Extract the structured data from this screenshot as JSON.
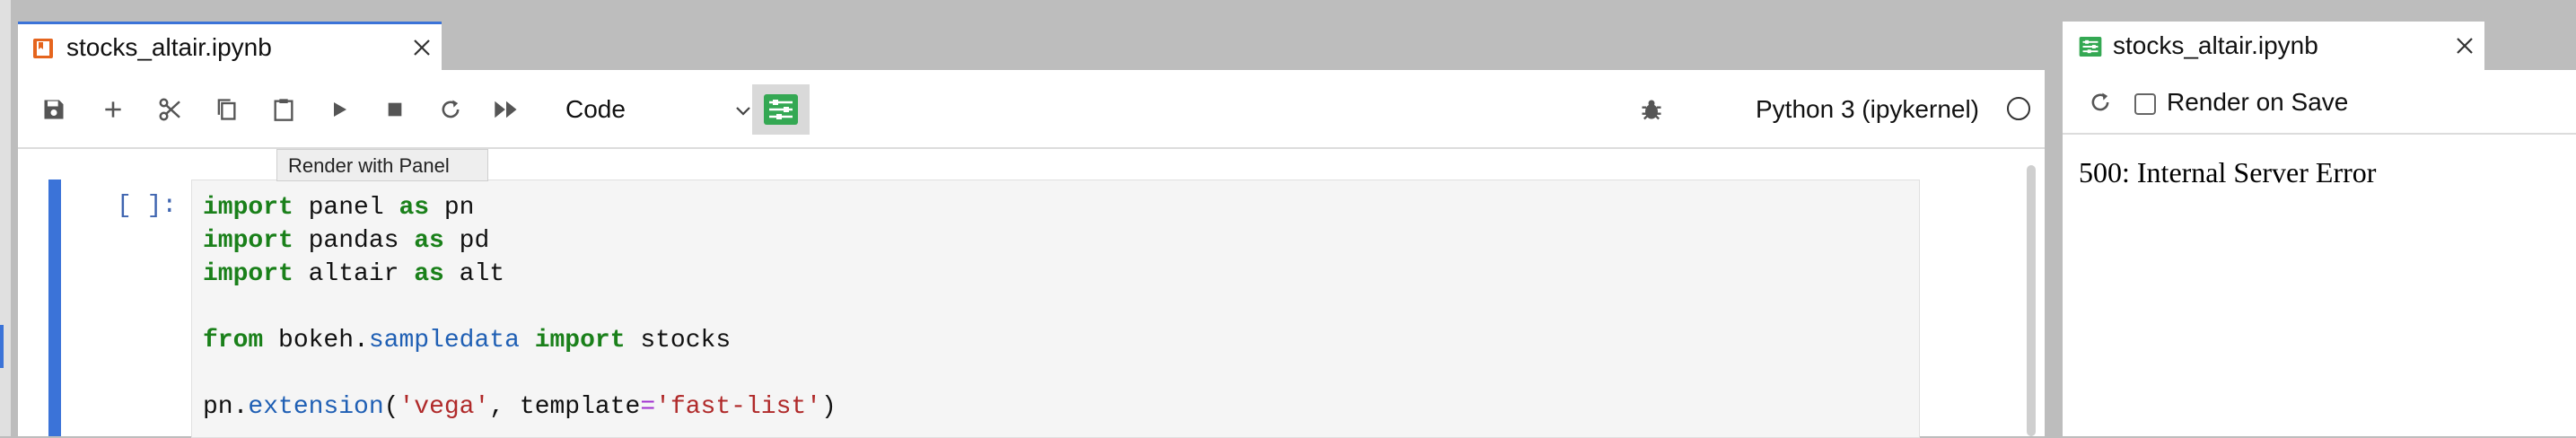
{
  "notebook": {
    "tab_title": "stocks_altair.ipynb",
    "toolbar": {
      "cell_type": "Code",
      "tooltip": "Render with Panel",
      "kernel_name": "Python 3 (ipykernel)"
    },
    "cell": {
      "prompt": "[ ]:",
      "code": [
        [
          {
            "t": "import",
            "c": "kw"
          },
          {
            "t": " panel ",
            "c": ""
          },
          {
            "t": "as",
            "c": "kw"
          },
          {
            "t": " pn",
            "c": ""
          }
        ],
        [
          {
            "t": "import",
            "c": "kw"
          },
          {
            "t": " pandas ",
            "c": ""
          },
          {
            "t": "as",
            "c": "kw"
          },
          {
            "t": " pd",
            "c": ""
          }
        ],
        [
          {
            "t": "import",
            "c": "kw"
          },
          {
            "t": " altair ",
            "c": ""
          },
          {
            "t": "as",
            "c": "kw"
          },
          {
            "t": " alt",
            "c": ""
          }
        ],
        [],
        [
          {
            "t": "from",
            "c": "kw"
          },
          {
            "t": " bokeh.",
            "c": ""
          },
          {
            "t": "sampledata",
            "c": "mod"
          },
          {
            "t": " ",
            "c": ""
          },
          {
            "t": "import",
            "c": "kw"
          },
          {
            "t": " stocks",
            "c": ""
          }
        ],
        [],
        [
          {
            "t": "pn.",
            "c": ""
          },
          {
            "t": "extension",
            "c": "mod"
          },
          {
            "t": "(",
            "c": ""
          },
          {
            "t": "'vega'",
            "c": "str"
          },
          {
            "t": ", template",
            "c": ""
          },
          {
            "t": "=",
            "c": "op"
          },
          {
            "t": "'fast-list'",
            "c": "str"
          },
          {
            "t": ")",
            "c": ""
          }
        ]
      ]
    }
  },
  "preview": {
    "tab_title": "stocks_altair.ipynb",
    "render_on_save_label": "Render on Save",
    "render_on_save_checked": false,
    "content": "500: Internal Server Error"
  },
  "colors": {
    "accent": "#3b73d8",
    "notebook_icon": "#e5651e",
    "panel_icon": "#34a853",
    "keyword": "#1a801a",
    "string": "#b02a2a"
  }
}
